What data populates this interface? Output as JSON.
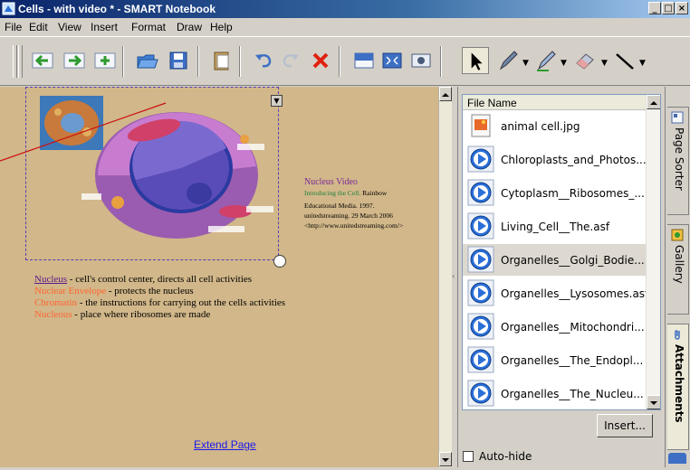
{
  "window": {
    "title": "Cells - with video * - SMART Notebook",
    "controls": [
      "_",
      "□",
      "×"
    ]
  },
  "menu": [
    "File",
    "Edit",
    "View",
    "Insert",
    "Format",
    "Draw",
    "Help"
  ],
  "toolbar": {
    "buttons": [
      "previous-page",
      "next-page",
      "add-page",
      "open-file",
      "save",
      "paste",
      "undo",
      "redo",
      "delete",
      "screen-shade",
      "full-screen",
      "capture",
      "select",
      "pen",
      "creative-pen",
      "eraser",
      "line"
    ]
  },
  "page": {
    "video_title": "Nucleus Video",
    "citation_line1_part1": "Introducing the Cell.",
    "citation_line1_part2": " Rainbow",
    "citation_line2": "Educational Media. 1997.",
    "citation_line3": "unitedstreaming. 29 March 2006",
    "citation_line4": "<http://www.unitedstreaming.com/>",
    "defs": [
      {
        "term": "Nucleus",
        "text": " - cell's control center, directs all cell activities",
        "term_color": "#5b1a8a"
      },
      {
        "term": "Nuclear Envelope",
        "text": " - protects the nucleus",
        "term_color": "#ff6633"
      },
      {
        "term": "Chromatin",
        "text": " - the instructions for carrying out the cells activities",
        "term_color": "#ff6633"
      },
      {
        "term": "Nucleous",
        "text": " -  place where ribosomes are made",
        "term_color": "#ff6633"
      }
    ],
    "extend_link": "Extend Page"
  },
  "attachments": {
    "column_header": "File Name",
    "files": [
      {
        "name": "animal cell.jpg",
        "icon": "image-file-icon"
      },
      {
        "name": "Chloroplasts_and_Photos...",
        "icon": "media-file-icon"
      },
      {
        "name": "Cytoplasm__Ribosomes_...",
        "icon": "media-file-icon"
      },
      {
        "name": "Living_Cell__The.asf",
        "icon": "media-file-icon"
      },
      {
        "name": "Organelles__Golgi_Bodie...",
        "icon": "media-file-icon",
        "selected": true
      },
      {
        "name": "Organelles__Lysosomes.asf",
        "icon": "media-file-icon"
      },
      {
        "name": "Organelles__Mitochondri...",
        "icon": "media-file-icon"
      },
      {
        "name": "Organelles__The_Endopl...",
        "icon": "media-file-icon"
      },
      {
        "name": "Organelles__The_Nucleu...",
        "icon": "media-file-icon"
      }
    ],
    "insert_button": "Insert...",
    "autohide_label": "Auto-hide",
    "autohide_checked": false
  },
  "side_tabs": [
    "Page Sorter",
    "Gallery",
    "Attachments"
  ]
}
